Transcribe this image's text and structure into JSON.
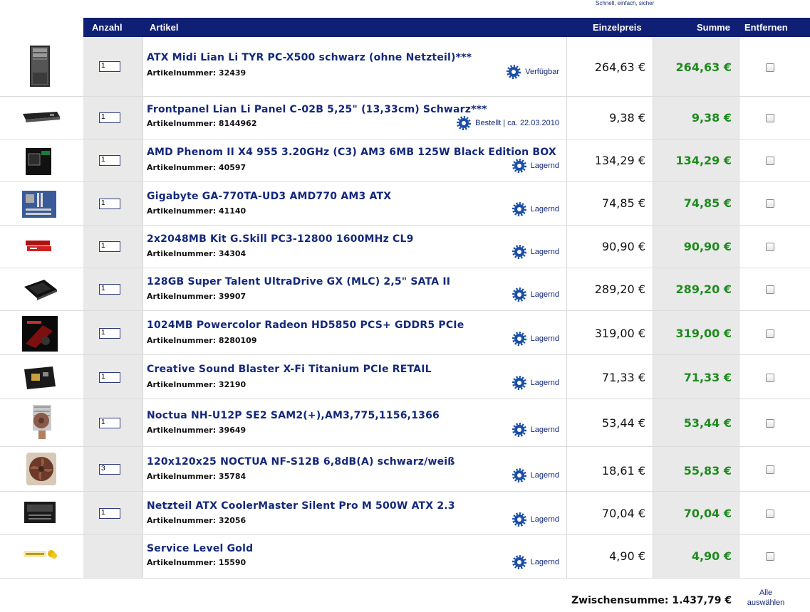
{
  "tagline": "Schnell, einfach, sicher",
  "header": {
    "anzahl": "Anzahl",
    "artikel": "Artikel",
    "einzelpreis": "Einzelpreis",
    "summe": "Summe",
    "entfernen": "Entfernen"
  },
  "items": [
    {
      "qty": "1",
      "name": "ATX Midi Lian Li TYR PC-X500 schwarz (ohne Netzteil)***",
      "artnr": "Artikelnummer: 32439",
      "status": "Verfügbar",
      "price": "264,63 €",
      "sum": "264,63 €",
      "image": "pc-case-icon"
    },
    {
      "qty": "1",
      "name": "Frontpanel Lian Li Panel C-02B 5,25\" (13,33cm) Schwarz***",
      "artnr": "Artikelnummer: 8144962",
      "status": "Bestellt | ca. 22.03.2010",
      "price": "9,38 €",
      "sum": "9,38 €",
      "image": "frontpanel-icon"
    },
    {
      "qty": "1",
      "name": "AMD Phenom II X4 955 3.20GHz (C3) AM3 6MB 125W Black Edition BOX",
      "artnr": "Artikelnummer: 40597",
      "status": "Lagernd",
      "price": "134,29 €",
      "sum": "134,29 €",
      "image": "cpu-box-icon"
    },
    {
      "qty": "1",
      "name": "Gigabyte GA-770TA-UD3 AMD770 AM3 ATX",
      "artnr": "Artikelnummer: 41140",
      "status": "Lagernd",
      "price": "74,85 €",
      "sum": "74,85 €",
      "image": "motherboard-icon"
    },
    {
      "qty": "1",
      "name": "2x2048MB Kit G.Skill PC3-12800 1600MHz CL9",
      "artnr": "Artikelnummer: 34304",
      "status": "Lagernd",
      "price": "90,90 €",
      "sum": "90,90 €",
      "image": "ram-icon"
    },
    {
      "qty": "1",
      "name": "128GB Super Talent UltraDrive GX (MLC) 2,5\" SATA II",
      "artnr": "Artikelnummer: 39907",
      "status": "Lagernd",
      "price": "289,20 €",
      "sum": "289,20 €",
      "image": "ssd-icon"
    },
    {
      "qty": "1",
      "name": "1024MB Powercolor Radeon HD5850 PCS+ GDDR5 PCIe",
      "artnr": "Artikelnummer: 8280109",
      "status": "Lagernd",
      "price": "319,00 €",
      "sum": "319,00 €",
      "image": "graphics-card-icon"
    },
    {
      "qty": "1",
      "name": "Creative Sound Blaster X-Fi Titanium PCIe RETAIL",
      "artnr": "Artikelnummer: 32190",
      "status": "Lagernd",
      "price": "71,33 €",
      "sum": "71,33 €",
      "image": "sound-card-icon"
    },
    {
      "qty": "1",
      "name": "Noctua NH-U12P SE2 SAM2(+),AM3,775,1156,1366",
      "artnr": "Artikelnummer: 39649",
      "status": "Lagernd",
      "price": "53,44 €",
      "sum": "53,44 €",
      "image": "cpu-cooler-icon"
    },
    {
      "qty": "3",
      "name": "120x120x25 NOCTUA NF-S12B 6,8dB(A) schwarz/weiß",
      "artnr": "Artikelnummer: 35784",
      "status": "Lagernd",
      "price": "18,61 €",
      "sum": "55,83 €",
      "image": "case-fan-icon"
    },
    {
      "qty": "1",
      "name": "Netzteil ATX CoolerMaster Silent Pro M 500W ATX 2.3",
      "artnr": "Artikelnummer: 32056",
      "status": "Lagernd",
      "price": "70,04 €",
      "sum": "70,04 €",
      "image": "psu-icon"
    },
    {
      "qty": "",
      "name": "Service Level Gold",
      "artnr": "Artikelnummer: 15590",
      "status": "Lagernd",
      "price": "4,90 €",
      "sum": "4,90 €",
      "image": "service-gold-icon"
    }
  ],
  "footer": {
    "subtotal": "Zwischensumme: 1.437,79 €",
    "select_all_line1": "Alle",
    "select_all_line2": "auswählen"
  },
  "colors": {
    "header_bg": "#0f1f73",
    "link_blue": "#14287a",
    "sum_green": "#1f8a1f",
    "shaded_cell": "#e9e9e9"
  }
}
